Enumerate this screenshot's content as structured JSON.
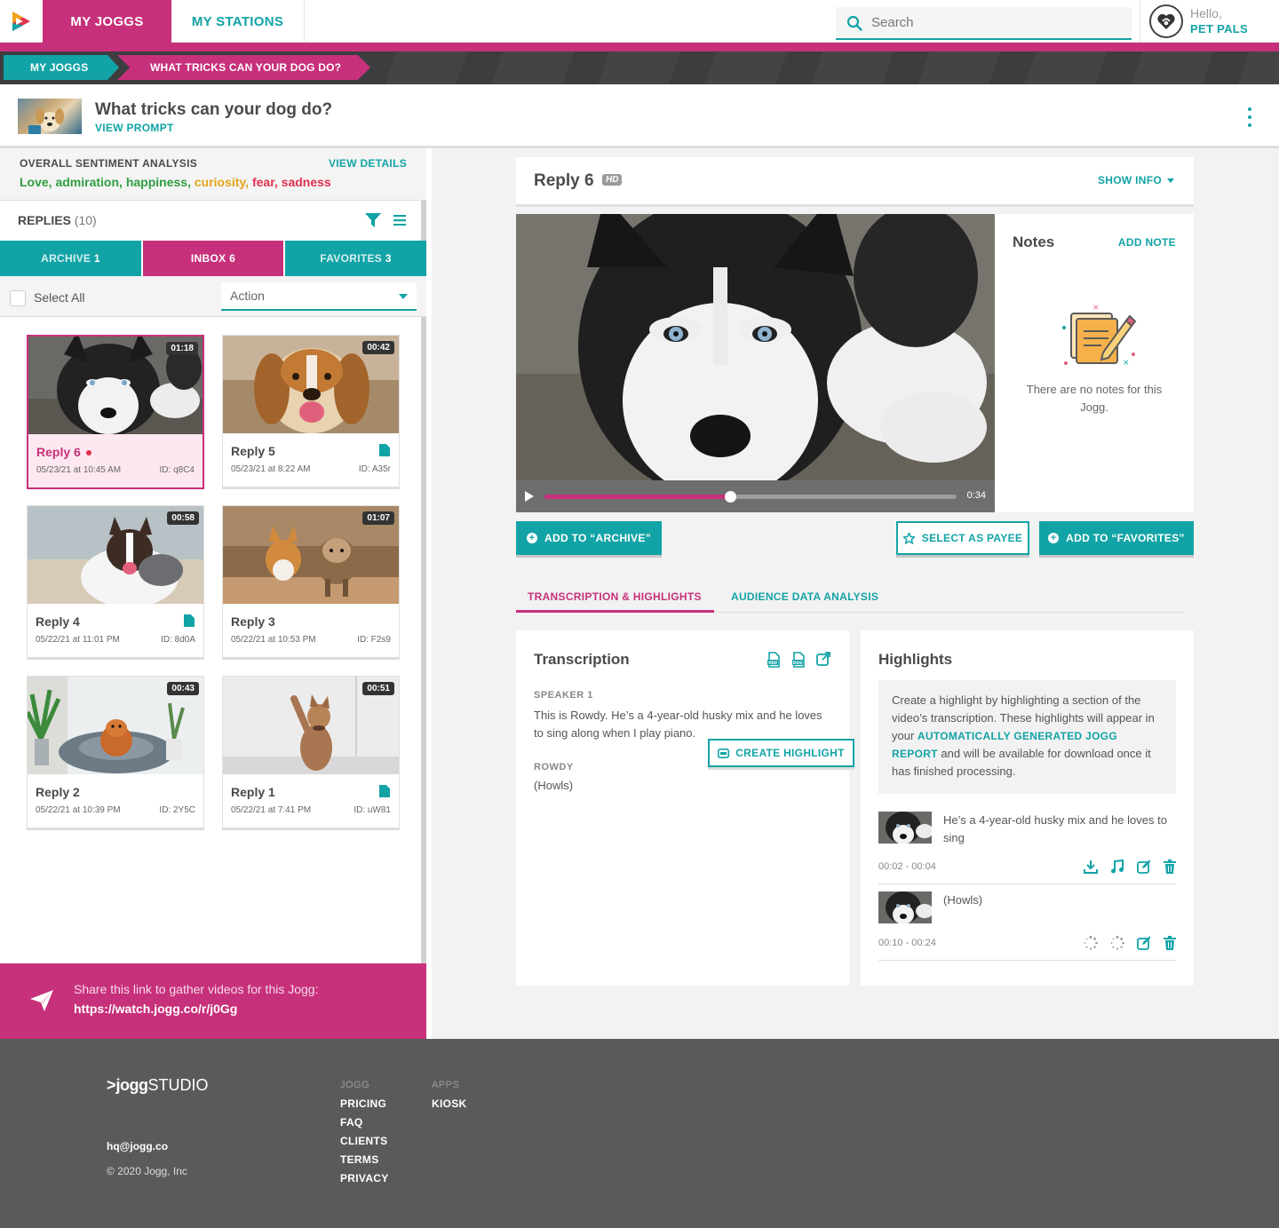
{
  "nav": {
    "tabs": [
      {
        "label": "MY JOGGS",
        "active": true
      },
      {
        "label": "MY STATIONS",
        "active": false
      }
    ],
    "search_placeholder": "Search",
    "user": {
      "greeting": "Hello,",
      "name": "PET PALS"
    }
  },
  "breadcrumb": [
    "MY JOGGS",
    "WHAT TRICKS CAN YOUR DOG DO?"
  ],
  "prompt": {
    "title": "What tricks can your dog do?",
    "view_label": "VIEW PROMPT"
  },
  "sentiment": {
    "label": "OVERALL SENTIMENT ANALYSIS",
    "details_label": "VIEW DETAILS",
    "words": [
      {
        "text": "Love,",
        "color": "#2e9e3f"
      },
      {
        "text": "admiration,",
        "color": "#2e9e3f"
      },
      {
        "text": "happiness,",
        "color": "#2e9e3f"
      },
      {
        "text": "curiosity,",
        "color": "#e4a31c"
      },
      {
        "text": "fear,",
        "color": "#e0314e"
      },
      {
        "text": "sadness",
        "color": "#e0314e"
      }
    ]
  },
  "replies": {
    "label": "REPLIES",
    "count": "(10)",
    "tabs": {
      "archive": {
        "label": "ARCHIVE",
        "count": "1"
      },
      "inbox": {
        "label": "INBOX",
        "count": "6"
      },
      "favorites": {
        "label": "FAVORITES",
        "count": "3"
      }
    },
    "select_all": "Select All",
    "action": "Action",
    "cards": [
      {
        "title": "Reply 6",
        "date": "05/23/21 at 10:45 AM",
        "id": "ID: q8C4",
        "duration": "01:18",
        "selected": true,
        "unread": true,
        "doc": false
      },
      {
        "title": "Reply 5",
        "date": "05/23/21 at 8:22 AM",
        "id": "ID: A35r",
        "duration": "00:42",
        "selected": false,
        "unread": false,
        "doc": true
      },
      {
        "title": "Reply 4",
        "date": "05/22/21 at 11:01 PM",
        "id": "ID: 8d0A",
        "duration": "00:58",
        "selected": false,
        "unread": false,
        "doc": true
      },
      {
        "title": "Reply 3",
        "date": "05/22/21 at 10:53 PM",
        "id": "ID: F2s9",
        "duration": "01:07",
        "selected": false,
        "unread": false,
        "doc": false
      },
      {
        "title": "Reply 2",
        "date": "05/22/21 at 10:39 PM",
        "id": "ID: 2Y5C",
        "duration": "00:43",
        "selected": false,
        "unread": false,
        "doc": false
      },
      {
        "title": "Reply 1",
        "date": "05/22/21 at 7:41 PM",
        "id": "ID: uW81",
        "duration": "00:51",
        "selected": false,
        "unread": false,
        "doc": true
      }
    ]
  },
  "share": {
    "text": "Share this link to gather videos for this Jogg:",
    "link": "https://watch.jogg.co/r/j0Gg"
  },
  "detail": {
    "title": "Reply 6",
    "badge": "HD",
    "show_info": "SHOW INFO",
    "video": {
      "time": "0:34",
      "progress": 0.45
    },
    "notes": {
      "title": "Notes",
      "add_label": "ADD NOTE",
      "empty": "There are no notes for this Jogg."
    },
    "buttons": {
      "archive": "ADD TO “ARCHIVE”",
      "payee": "SELECT AS PAYEE",
      "favorites": "ADD TO “FAVORITES”"
    },
    "tabs": [
      "TRANSCRIPTION & HIGHLIGHTS",
      "AUDIENCE DATA ANALYSIS"
    ],
    "transcription": {
      "title": "Transcription",
      "create_label": "CREATE HIGHLIGHT",
      "entries": [
        {
          "speaker": "SPEAKER 1",
          "text": "This is Rowdy. He’s a 4-year-old husky mix and he loves to sing along when I play piano."
        },
        {
          "speaker": "ROWDY",
          "text": "(Howls)"
        }
      ]
    },
    "highlights": {
      "title": "Highlights",
      "info_parts": [
        "Create a highlight by highlighting a section of the video’s transcription. These highlights will appear in your ",
        "AUTOMATICALLY GENERATED JOGG REPORT",
        " and will be available for download once it has finished processing."
      ],
      "items": [
        {
          "text": "He’s a 4-year-old husky mix and he loves to sing",
          "time": "00:02 - 00:04",
          "processing": false
        },
        {
          "text": "(Howls)",
          "time": "00:10 - 00:24",
          "processing": true
        }
      ]
    }
  },
  "footer": {
    "brand": "jogg",
    "brand_suffix": "STUDIO",
    "email": "hq@jogg.co",
    "copyright": "© 2020 Jogg, Inc",
    "columns": [
      {
        "heading": "JOGG",
        "links": [
          "PRICING",
          "FAQ",
          "CLIENTS",
          "TERMS",
          "PRIVACY"
        ]
      },
      {
        "heading": "APPS",
        "links": [
          "KIOSK"
        ]
      }
    ]
  },
  "colors": {
    "brand_teal": "#12a3a6",
    "brand_magenta": "#c7307a",
    "footer": "#5a5a5c"
  }
}
